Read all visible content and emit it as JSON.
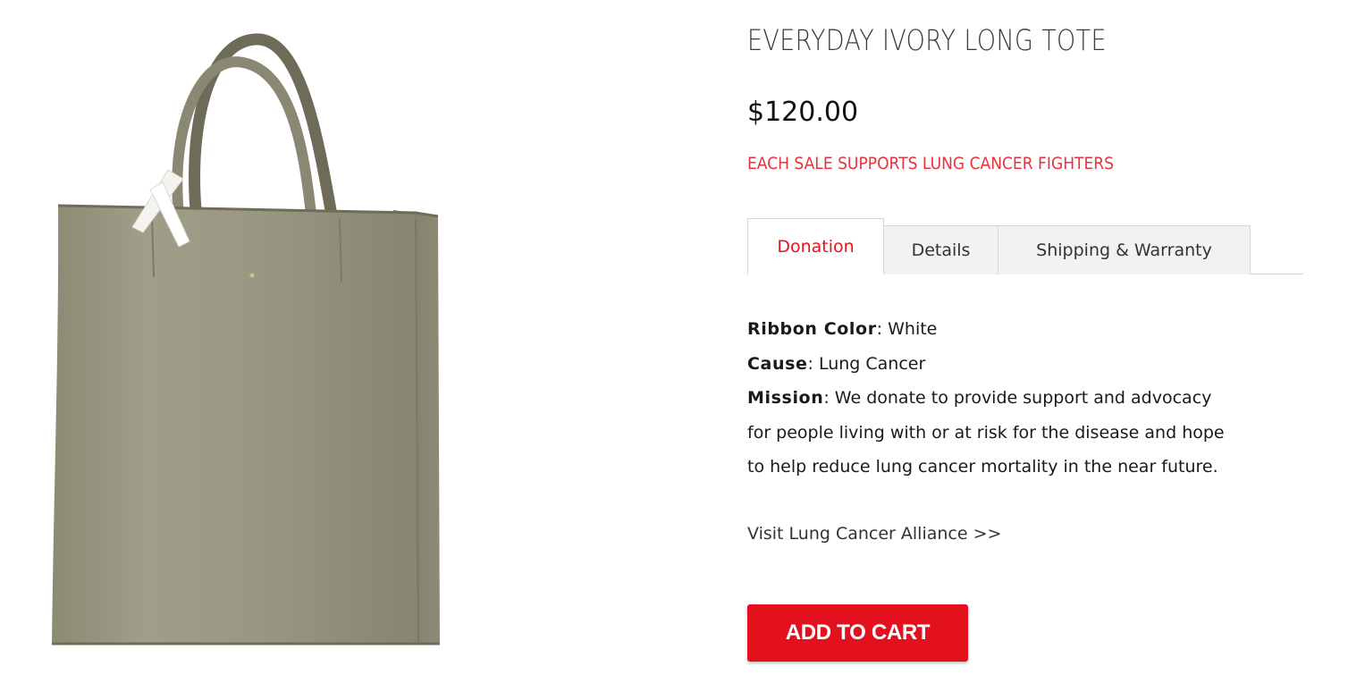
{
  "product": {
    "title": "EVERYDAY IVORY LONG TOTE",
    "price": "$120.00",
    "tagline": "EACH SALE SUPPORTS LUNG CANCER FIGHTERS",
    "image_icon": "tote-bag-illustration"
  },
  "tabs": [
    {
      "label": "Donation",
      "active": true
    },
    {
      "label": "Details",
      "active": false
    },
    {
      "label": "Shipping & Warranty",
      "active": false
    }
  ],
  "donation": {
    "ribbon_label": "Ribbon Color",
    "ribbon_value": "White",
    "cause_label": "Cause",
    "cause_value": "Lung Cancer",
    "mission_label": "Mission",
    "mission_line1": "We donate to provide support and advocacy",
    "mission_line2": "for people living with or at risk for the disease and hope",
    "mission_line3": "to help reduce lung cancer mortality in the near future."
  },
  "visit_link": "Visit Lung Cancer Alliance >>",
  "cart": {
    "label": "ADD TO CART"
  },
  "colors": {
    "accent_red": "#e3101d",
    "tagline_red": "#e8323c",
    "bag_olive": "#9b9a84"
  }
}
